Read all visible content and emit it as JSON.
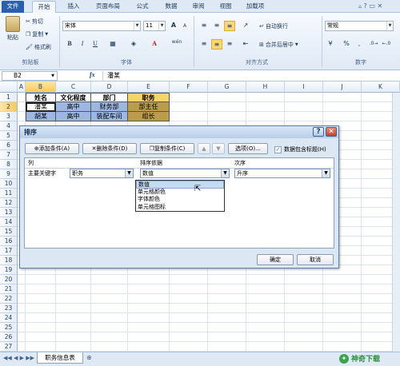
{
  "ribbon_tabs": [
    "文件",
    "开始",
    "插入",
    "页面布局",
    "公式",
    "数据",
    "审阅",
    "视图",
    "加载项"
  ],
  "active_tab_index": 1,
  "clipboard": {
    "paste": "粘贴",
    "cut": "剪切",
    "copy": "复制",
    "format_painter": "格式刷",
    "group": "剪贴板"
  },
  "font": {
    "name": "宋体",
    "size": "11",
    "group": "字体",
    "bold": "B",
    "italic": "I",
    "underline": "U",
    "grow": "A",
    "shrink": "A",
    "font_color": "A",
    "pinyin": "wén"
  },
  "alignment": {
    "wrap": "自动换行",
    "merge": "合并后居中",
    "group": "对齐方式"
  },
  "number": {
    "format": "常规",
    "percent": "%",
    "comma": ",",
    "group": "数字"
  },
  "name_box": "B2",
  "fx": "fx",
  "formula_value": "潘某",
  "columns": [
    "A",
    "B",
    "C",
    "D",
    "E",
    "F",
    "G",
    "H",
    "I",
    "J",
    "K"
  ],
  "rows": [
    "1",
    "2",
    "3",
    "4",
    "5",
    "6",
    "7",
    "8",
    "9",
    "10",
    "11",
    "12",
    "13",
    "14",
    "15",
    "16",
    "17",
    "18",
    "19",
    "20",
    "21",
    "22",
    "23",
    "24",
    "25",
    "26",
    "27"
  ],
  "table": {
    "headers": [
      "姓名",
      "文化程度",
      "部门",
      "职务"
    ],
    "rows": [
      [
        "潘某",
        "高中",
        "财务部",
        "部主任"
      ],
      [
        "胡某",
        "高中",
        "装配车间",
        "组长"
      ]
    ]
  },
  "dialog": {
    "title": "排序",
    "help": "?",
    "close": "✕",
    "add_level": "添加条件(A)",
    "delete_level": "删除条件(D)",
    "copy_level": "复制条件(C)",
    "move_up": "▲",
    "move_down": "▼",
    "options": "选项(O)...",
    "has_headers": "数据包含标题(H)",
    "has_headers_checked": true,
    "col_header": "列",
    "sort_on_header": "排序依据",
    "order_header": "次序",
    "row_label": "主要关键字",
    "column_value": "职务",
    "sort_on_value": "数值",
    "order_value": "升序",
    "sort_on_options": [
      "数值",
      "单元格颜色",
      "字体颜色",
      "单元格图标"
    ],
    "highlighted_option": 0,
    "ok": "确定",
    "cancel": "取消"
  },
  "sheet_tab": "职务信息表",
  "watermark": "神奇下载",
  "colors": {
    "header_fill": "#f7d36b",
    "row_fill": "#9bb7e2",
    "pos_fill": "#b99d4a",
    "accent": "#2a5faf"
  }
}
